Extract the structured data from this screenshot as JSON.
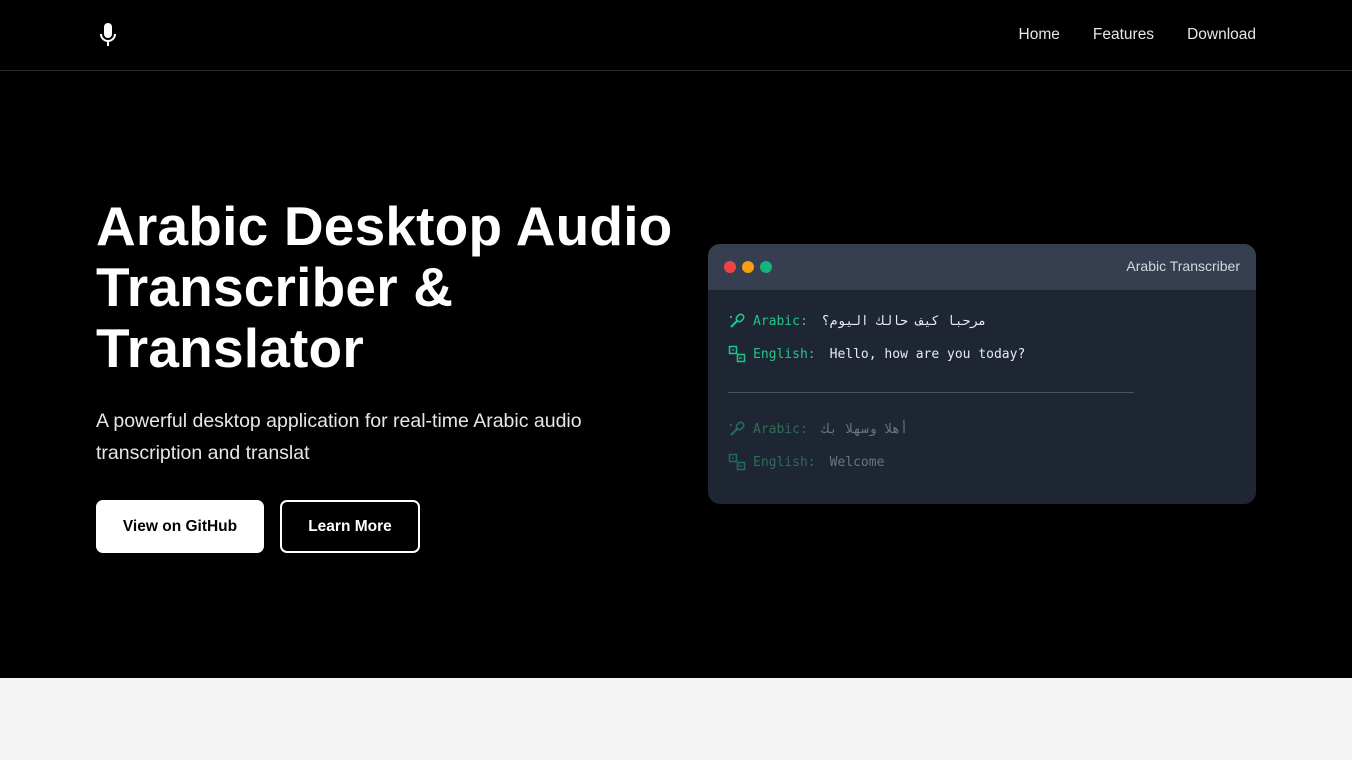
{
  "nav": {
    "logo_icon": "microphone-icon",
    "links": [
      "Home",
      "Features",
      "Download"
    ]
  },
  "hero": {
    "title": "Arabic Desktop Audio Transcriber & Translator",
    "subtitle": "A powerful desktop application for real-time Arabic audio transcription and translat",
    "primary_button": "View on GitHub",
    "secondary_button": "Learn More"
  },
  "demo_window": {
    "title": "Arabic Transcriber",
    "accent_color": "#22c48a",
    "entries": [
      {
        "arabic_label": "Arabic:",
        "arabic_text": "مرحبا كيف حالك اليوم؟",
        "english_label": "English:",
        "english_text": "Hello, how are you today?"
      },
      {
        "arabic_label": "Arabic:",
        "arabic_text": "أهلا وسهلا بك",
        "english_label": "English:",
        "english_text": "Welcome"
      }
    ]
  }
}
